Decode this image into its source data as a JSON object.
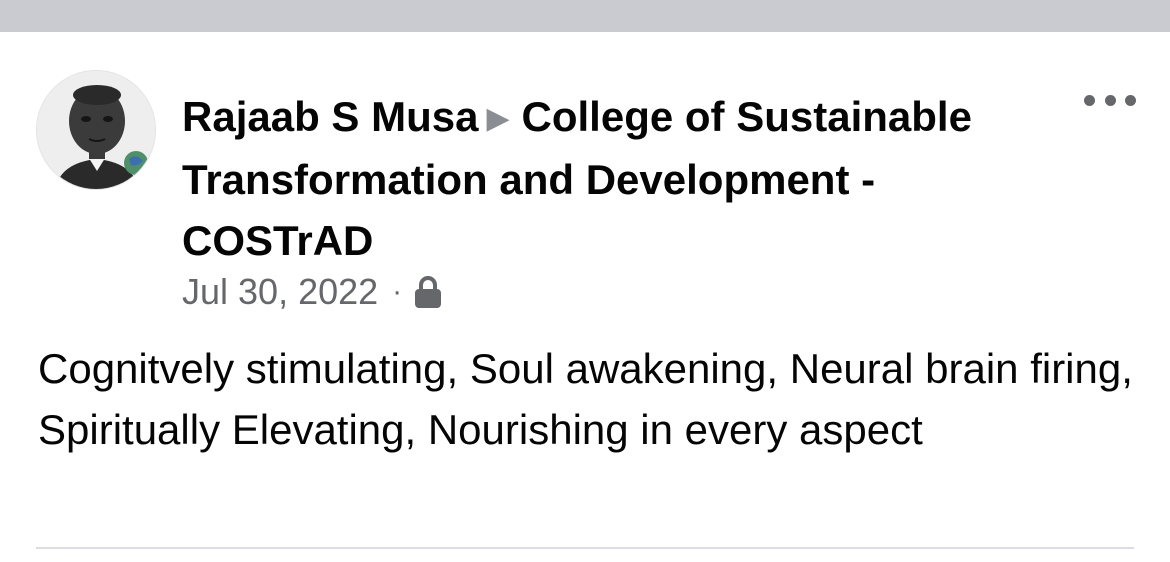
{
  "post": {
    "author": "Rajaab S Musa",
    "group": "College of Sustainable Transformation and Development - COSTrAD",
    "date": "Jul 30, 2022",
    "separator": "·",
    "privacy_icon": "lock-icon",
    "text": "Cognitvely stimulating, Soul awakening, Neural brain firing, Spiritually Elevating, Nourishing in every aspect",
    "more_icon": "more-options-icon"
  },
  "colors": {
    "top_strip": "#c9cbd1",
    "primary_text": "#050505",
    "secondary_text": "#65676b",
    "divider": "#dcdde0"
  }
}
